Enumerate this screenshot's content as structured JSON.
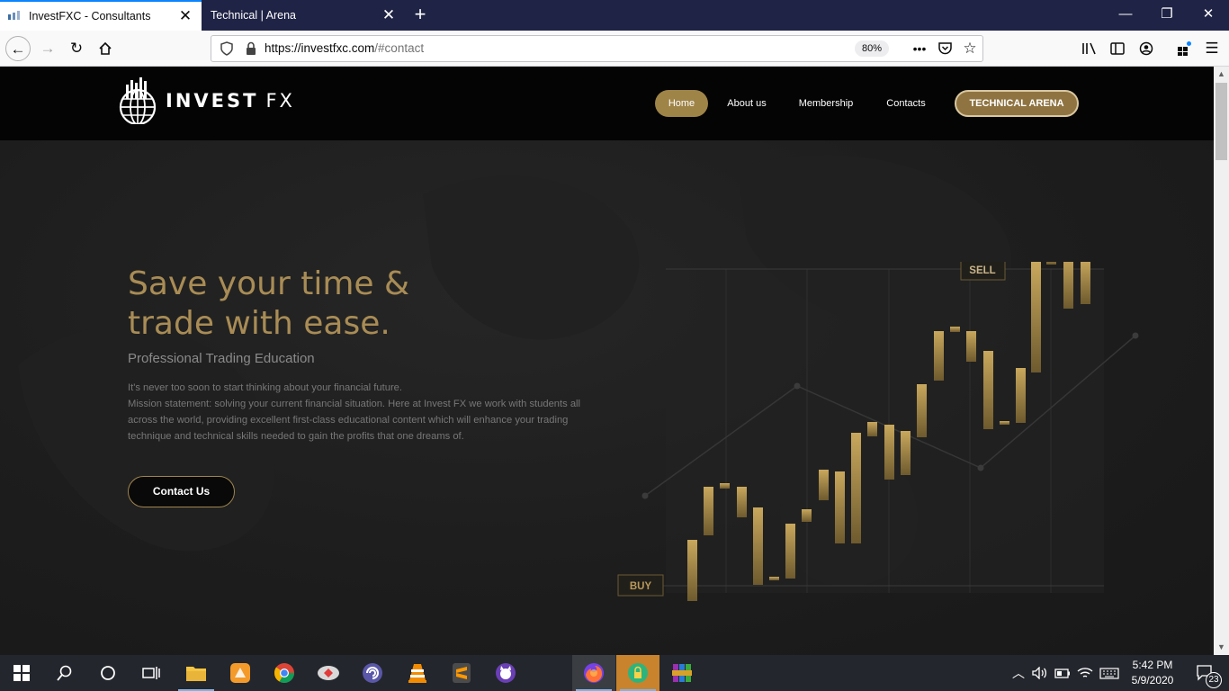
{
  "browser": {
    "tabs": [
      {
        "title": "InvestFXC - Consultants",
        "active": true
      },
      {
        "title": "Technical | Arena",
        "active": false
      }
    ],
    "url_host": "https://investfxc.com",
    "url_path": "/#contact",
    "zoom": "80%"
  },
  "site": {
    "logo_bold": "INVEST",
    "logo_thin": "FX",
    "nav": {
      "home": "Home",
      "about": "About us",
      "membership": "Membership",
      "contacts": "Contacts",
      "arena": "TECHNICAL ARENA"
    },
    "hero": {
      "title_line1": "Save your time &",
      "title_line2": "trade with ease.",
      "subtitle": "Professional Trading Education",
      "body_line1": "It's never too soon to start thinking about your financial future.",
      "body_line2": "Mission statement: solving your current financial situation. Here at Invest FX we work with students all across the world, providing excellent first-class educational content which will enhance your trading technique and technical skills needed to gain the profits that one dreams of.",
      "cta": "Contact Us"
    },
    "chart": {
      "sell_label": "SELL",
      "buy_label": "BUY"
    }
  },
  "taskbar": {
    "time": "5:42 PM",
    "date": "5/9/2020",
    "notifications": "23"
  },
  "colors": {
    "gold": "#a98c55",
    "header_bg": "#040404",
    "tabstrip_bg": "#1f2345",
    "accent_blue": "#0a84ff"
  }
}
